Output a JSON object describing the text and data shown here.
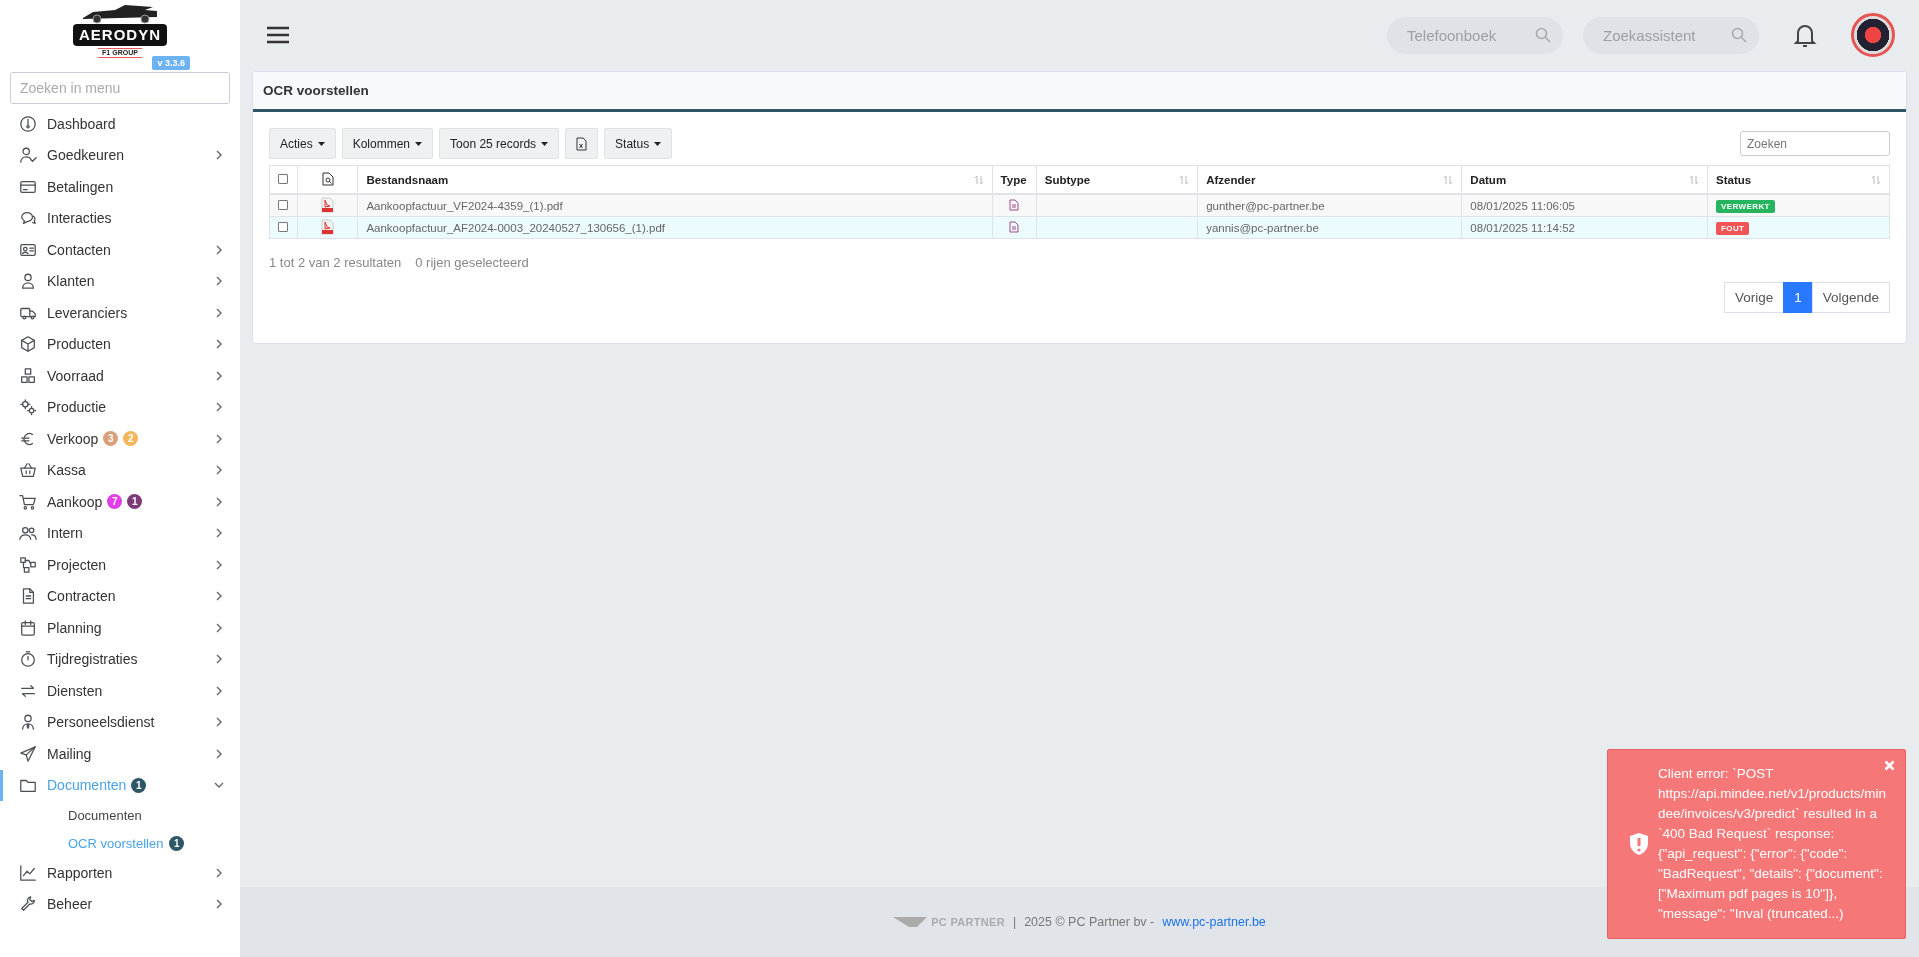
{
  "sidebar": {
    "logo": {
      "name": "AERODYN",
      "subtitle": "F1 GROUP"
    },
    "version": "v 3.3.6",
    "search": {
      "placeholder": "Zoeken in menu"
    },
    "items": [
      {
        "label": "Dashboard",
        "expandable": false,
        "expanded": false,
        "selected": false
      },
      {
        "label": "Goedkeuren",
        "expandable": true,
        "expanded": false,
        "selected": false
      },
      {
        "label": "Betalingen",
        "expandable": false,
        "expanded": false,
        "selected": false
      },
      {
        "label": "Interacties",
        "expandable": false,
        "expanded": false,
        "selected": false
      },
      {
        "label": "Contacten",
        "expandable": true,
        "expanded": false,
        "selected": false
      },
      {
        "label": "Klanten",
        "expandable": true,
        "expanded": false,
        "selected": false
      },
      {
        "label": "Leveranciers",
        "expandable": true,
        "expanded": false,
        "selected": false
      },
      {
        "label": "Producten",
        "expandable": true,
        "expanded": false,
        "selected": false
      },
      {
        "label": "Voorraad",
        "expandable": true,
        "expanded": false,
        "selected": false
      },
      {
        "label": "Productie",
        "expandable": true,
        "expanded": false,
        "selected": false
      },
      {
        "label": "Verkoop",
        "expandable": true,
        "expanded": false,
        "selected": false,
        "badges": [
          {
            "text": "3",
            "color": "#d9a07c"
          },
          {
            "text": "2",
            "color": "#f3b65c"
          }
        ]
      },
      {
        "label": "Kassa",
        "expandable": true,
        "expanded": false,
        "selected": false
      },
      {
        "label": "Aankoop",
        "expandable": true,
        "expanded": false,
        "selected": false,
        "badges": [
          {
            "text": "7",
            "color": "#e03ee8"
          },
          {
            "text": "1",
            "color": "#7d3a78"
          }
        ]
      },
      {
        "label": "Intern",
        "expandable": true,
        "expanded": false,
        "selected": false
      },
      {
        "label": "Projecten",
        "expandable": true,
        "expanded": false,
        "selected": false
      },
      {
        "label": "Contracten",
        "expandable": true,
        "expanded": false,
        "selected": false
      },
      {
        "label": "Planning",
        "expandable": true,
        "expanded": false,
        "selected": false
      },
      {
        "label": "Tijdregistraties",
        "expandable": true,
        "expanded": false,
        "selected": false
      },
      {
        "label": "Diensten",
        "expandable": true,
        "expanded": false,
        "selected": false
      },
      {
        "label": "Personeelsdienst",
        "expandable": true,
        "expanded": false,
        "selected": false
      },
      {
        "label": "Mailing",
        "expandable": true,
        "expanded": false,
        "selected": false
      },
      {
        "label": "Documenten",
        "expandable": true,
        "expanded": true,
        "selected": true,
        "badges": [
          {
            "text": "1",
            "color": "#2d5766"
          }
        ],
        "children": [
          {
            "label": "Documenten",
            "selected": false
          },
          {
            "label": "OCR voorstellen",
            "selected": true,
            "badges": [
              {
                "text": "1",
                "color": "#2d5766"
              }
            ]
          }
        ]
      },
      {
        "label": "Rapporten",
        "expandable": true,
        "expanded": false,
        "selected": false
      },
      {
        "label": "Beheer",
        "expandable": true,
        "expanded": false,
        "selected": false
      }
    ]
  },
  "topbar": {
    "search_fields": [
      {
        "placeholder": "Telefoonboek"
      },
      {
        "placeholder": "Zoekassistent"
      }
    ]
  },
  "card": {
    "title": "OCR voorstellen",
    "toolbar": [
      {
        "kind": "dropdown",
        "label": "Acties"
      },
      {
        "kind": "dropdown",
        "label": "Kolommen"
      },
      {
        "kind": "dropdown",
        "label": "Toon 25 records"
      },
      {
        "kind": "export"
      },
      {
        "kind": "dropdown",
        "label": "Status"
      }
    ],
    "search": {
      "placeholder": "Zoeken"
    },
    "table": {
      "columns": [
        {
          "kind": "checkbox",
          "checked": false
        },
        {
          "kind": "icon"
        },
        {
          "kind": "text",
          "label": "Bestandsnaam",
          "sortable": true
        },
        {
          "kind": "text",
          "label": "Type",
          "sortable": false
        },
        {
          "kind": "text",
          "label": "Subtype",
          "sortable": true
        },
        {
          "kind": "text",
          "label": "Afzender",
          "sortable": true
        },
        {
          "kind": "text",
          "label": "Datum",
          "sortable": true
        },
        {
          "kind": "text",
          "label": "Status",
          "sortable": true
        }
      ],
      "rows": [
        {
          "checked": false,
          "highlighted": false,
          "filename": "Aankoopfactuur_VF2024-4359_(1).pdf",
          "sender": "gunther@pc-partner.be",
          "date": "08/01/2025 11:06:05",
          "status": {
            "text": "VERWERKT",
            "color": "#27b45f"
          }
        },
        {
          "checked": false,
          "highlighted": true,
          "filename": "Aankoopfactuur_AF2024-0003_20240527_130656_(1).pdf",
          "sender": "yannis@pc-partner.be",
          "date": "08/01/2025 11:14:52",
          "status": {
            "text": "FOUT",
            "color": "#f05454"
          }
        }
      ]
    },
    "summary": "1 tot 2 van 2 resultaten",
    "selection": "0 rijen geselecteerd",
    "pagination": [
      {
        "label": "Vorige",
        "selected": false
      },
      {
        "label": "1",
        "selected": true
      },
      {
        "label": "Volgende",
        "selected": false
      }
    ]
  },
  "footer": {
    "logo_text": "PC PARTNER",
    "separator": "|",
    "text": "2025 © PC Partner bv -",
    "link": "www.pc-partner.be"
  },
  "toast": {
    "message": "Client error: `POST https://api.mindee.net/v1/products/mindee/invoices/v3/predict` resulted in a `400 Bad Request` response: {\"api_request\": {\"error\": {\"code\": \"BadRequest\", \"details\": {\"document\": [\"Maximum pdf pages is 10\"]}, \"message\": \"Inval (truncated...)"
  }
}
